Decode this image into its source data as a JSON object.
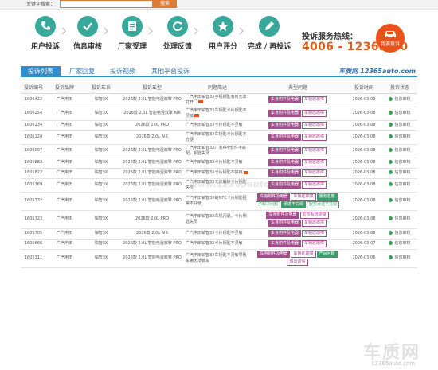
{
  "search": {
    "label": "关键字搜索：",
    "placeholder": "",
    "button": "搜索"
  },
  "steps": [
    {
      "label": "用户投诉",
      "icon": "phone-icon"
    },
    {
      "label": "信息审核",
      "icon": "check-icon"
    },
    {
      "label": "厂家受理",
      "icon": "document-icon"
    },
    {
      "label": "处理反馈",
      "icon": "refresh-icon"
    },
    {
      "label": "用户评分",
      "icon": "star-icon"
    },
    {
      "label": "完成 / 再投诉",
      "icon": "edit-icon"
    }
  ],
  "hotline": {
    "label": "投诉服务热线：",
    "number": "4006 - 12365 - 0"
  },
  "complain_button": "我要投诉",
  "tabs": [
    "投诉列表",
    "厂家回复",
    "投诉视频",
    "其他平台投诉"
  ],
  "brand": "车质网 12365auto.com",
  "watermark": "www.12365auto.com",
  "logo_watermark": {
    "big": "车质网",
    "small": "12365auto.com"
  },
  "colors": {
    "teal": "#37a89a",
    "orange": "#e05a18",
    "blue": "#2f8ecf",
    "purple": "#a34d8c",
    "green": "#3a9f6e"
  },
  "table": {
    "headers": [
      "投诉编号",
      "投诉品牌",
      "投诉车系",
      "投诉车型",
      "问题简述",
      "典型问题",
      "投诉时间",
      "投诉状态"
    ],
    "rows": [
      {
        "id": "1606422",
        "brand": "广汽丰田",
        "series": "铂智3X",
        "model": "2026款 2.0L 智能电混双擎 PRO",
        "desc": "广汽丰田铂智3X手机钥匙有时无法打开门",
        "tags": [
          {
            "t": "车身附件及电器",
            "c": "purple"
          },
          {
            "t": "车钥匙故障",
            "c": "outline"
          }
        ],
        "date": "2026-03-09",
        "status": "信息审核",
        "icon": true
      },
      {
        "id": "1606254",
        "brand": "广汽丰田",
        "series": "铂智3X",
        "model": "2026款 2.0L 智能电混双擎 AIR",
        "desc": "广汽丰田铂智3X车钥匙卡片钥匙不灵敏",
        "tags": [
          {
            "t": "车身附件及电器",
            "c": "purple"
          },
          {
            "t": "车钥匙故障",
            "c": "outline"
          }
        ],
        "date": "2026-03-08",
        "status": "信息审核",
        "icon": true
      },
      {
        "id": "1606234",
        "brand": "广汽丰田",
        "series": "铂智3X",
        "model": "2026款 2.0L PRO",
        "desc": "广汽丰田铂智3X卡片钥匙不灵敏",
        "tags": [
          {
            "t": "车身附件及电器",
            "c": "purple"
          },
          {
            "t": "车钥匙故障",
            "c": "outline"
          }
        ],
        "date": "2026-03-08",
        "status": "信息审核",
        "icon": false
      },
      {
        "id": "1606124",
        "brand": "广汽丰田",
        "series": "铂智3X",
        "model": "2026款 2.0L AIR",
        "desc": "广汽丰田铂智3X车钥匙卡片钥匙不方便",
        "tags": [
          {
            "t": "车身附件及电器",
            "c": "purple"
          },
          {
            "t": "车钥匙故障",
            "c": "outline"
          }
        ],
        "date": "2026-03-08",
        "status": "信息审核",
        "icon": false
      },
      {
        "id": "1606097",
        "brand": "广汽丰田",
        "series": "铂智3X",
        "model": "2026款 2.0L 智能电混双擎 PRO",
        "desc": "广汽丰田铂智3X厂家APP软件不匹配，钥匙失灵",
        "tags": [
          {
            "t": "车身附件及电器",
            "c": "purple"
          },
          {
            "t": "车钥匙故障",
            "c": "outline"
          }
        ],
        "date": "2026-03-08",
        "status": "信息审核",
        "icon": false
      },
      {
        "id": "1605883",
        "brand": "广汽丰田",
        "series": "铂智3X",
        "model": "2026款 2.0L 智能电混双擎 PRO",
        "desc": "广汽丰田铂智3X卡片钥匙不灵敏",
        "tags": [
          {
            "t": "车身附件及电器",
            "c": "purple"
          },
          {
            "t": "车钥匙故障",
            "c": "outline"
          }
        ],
        "date": "2026-03-08",
        "status": "信息审核",
        "icon": false
      },
      {
        "id": "1605822",
        "brand": "广汽丰田",
        "series": "铂智3X",
        "model": "2026款 2.0L 智能电混双擎 PRO",
        "desc": "广汽丰田铂智3X卡片钥匙不好用",
        "tags": [
          {
            "t": "车身附件及电器",
            "c": "purple"
          },
          {
            "t": "车钥匙故障",
            "c": "outline"
          }
        ],
        "date": "2026-03-08",
        "status": "信息审核",
        "icon": true
      },
      {
        "id": "1605769",
        "brand": "广汽丰田",
        "series": "铂智3X",
        "model": "2026款 2.0L 智能电混双擎 PRO",
        "desc": "广汽丰田铂智3X无法解锁卡片钥匙失灵",
        "tags": [
          {
            "t": "车身附件及电器",
            "c": "purple"
          },
          {
            "t": "车钥匙故障",
            "c": "outline"
          }
        ],
        "date": "2026-03-08",
        "status": "信息审核",
        "icon": false
      },
      {
        "id": "1605732",
        "brand": "广汽丰田",
        "series": "铂智3X",
        "model": "2026款 2.0L 智能电混双擎 PRO",
        "desc": "广汽丰田铂智3X的NFC卡片钥匙经常不好使",
        "tags": [
          {
            "t": "车身附件及电器",
            "c": "purple"
          },
          {
            "t": "车钥匙故障",
            "c": "outline"
          },
          {
            "t": "服务态度",
            "c": "green"
          },
          {
            "t": "不解决问题",
            "c": "teal"
          },
          {
            "t": "承诺不兑现",
            "c": "green"
          },
          {
            "t": "服务承诺不兑现",
            "c": "teal"
          }
        ],
        "date": "2026-03-08",
        "status": "信息审核",
        "icon": false
      },
      {
        "id": "1605723",
        "brand": "广汽丰田",
        "series": "铂智3X",
        "model": "2026款 2.0L PRO",
        "desc": "广汽丰田铂智3X车机闪退，卡片钥匙失灵",
        "tags": [
          {
            "t": "车身附件及电器",
            "c": "purple"
          },
          {
            "t": "影音系统故障",
            "c": "outline"
          },
          {
            "t": "车身附件及电器",
            "c": "purple"
          },
          {
            "t": "车钥匙故障",
            "c": "outline"
          }
        ],
        "date": "2026-03-08",
        "status": "信息审核",
        "icon": false
      },
      {
        "id": "1605705",
        "brand": "广汽丰田",
        "series": "铂智3X",
        "model": "2026款 2.0L AIR",
        "desc": "广汽丰田铂智3X卡片钥匙不灵敏",
        "tags": [
          {
            "t": "车身附件及电器",
            "c": "purple"
          },
          {
            "t": "车钥匙故障",
            "c": "outline"
          }
        ],
        "date": "2026-03-08",
        "status": "信息审核",
        "icon": false
      },
      {
        "id": "1605666",
        "brand": "广汽丰田",
        "series": "铂智3X",
        "model": "2026款 2.0L 智能电混双擎 PRO",
        "desc": "广汽丰田铂智3X卡片钥匙不灵敏",
        "tags": [
          {
            "t": "车身附件及电器",
            "c": "purple"
          },
          {
            "t": "车钥匙故障",
            "c": "outline"
          }
        ],
        "date": "2026-03-07",
        "status": "信息审核",
        "icon": false
      },
      {
        "id": "1605311",
        "brand": "广汽丰田",
        "series": "铂智3X",
        "model": "2026款 2.0L 智能电混双擎 PRO",
        "desc": "广汽丰田铂智3X车钥匙不灵敏导致车辆无法锁车",
        "tags": [
          {
            "t": "车身附件及电器",
            "c": "purple"
          },
          {
            "t": "车钥匙故障",
            "c": "outline"
          },
          {
            "t": "产品问题",
            "c": "green"
          },
          {
            "t": "做出虚假",
            "c": "outline"
          }
        ],
        "date": "2026-03-06",
        "status": "信息审核",
        "icon": false
      }
    ]
  }
}
